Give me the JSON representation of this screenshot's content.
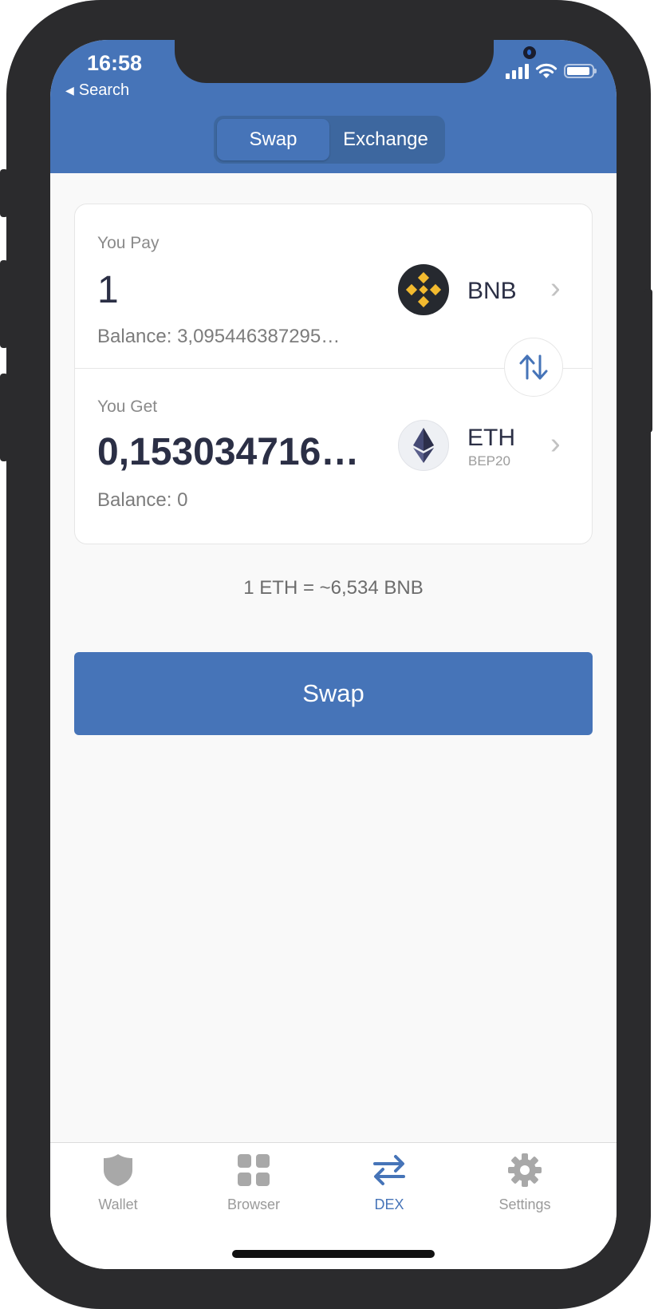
{
  "status_bar": {
    "time": "16:58",
    "back_label": "Search"
  },
  "segmented": {
    "items": [
      {
        "label": "Swap",
        "active": true
      },
      {
        "label": "Exchange",
        "active": false
      }
    ]
  },
  "pay": {
    "label": "You Pay",
    "amount": "1",
    "balance": "Balance: 3,095446387295…",
    "token": "BNB"
  },
  "get": {
    "label": "You Get",
    "amount": "0,153034716…",
    "balance": "Balance: 0",
    "token": "ETH",
    "network": "BEP20"
  },
  "rate": "1 ETH = ~6,534 BNB",
  "swap_button": "Swap",
  "tabs": [
    {
      "label": "Wallet",
      "icon": "shield-icon"
    },
    {
      "label": "Browser",
      "icon": "grid-icon"
    },
    {
      "label": "DEX",
      "icon": "swap-arrows-icon",
      "active": true
    },
    {
      "label": "Settings",
      "icon": "gear-icon"
    }
  ],
  "colors": {
    "brand": "#4674b8",
    "bnb_yellow": "#f3ba2f",
    "inactive": "#9a9a9a"
  }
}
